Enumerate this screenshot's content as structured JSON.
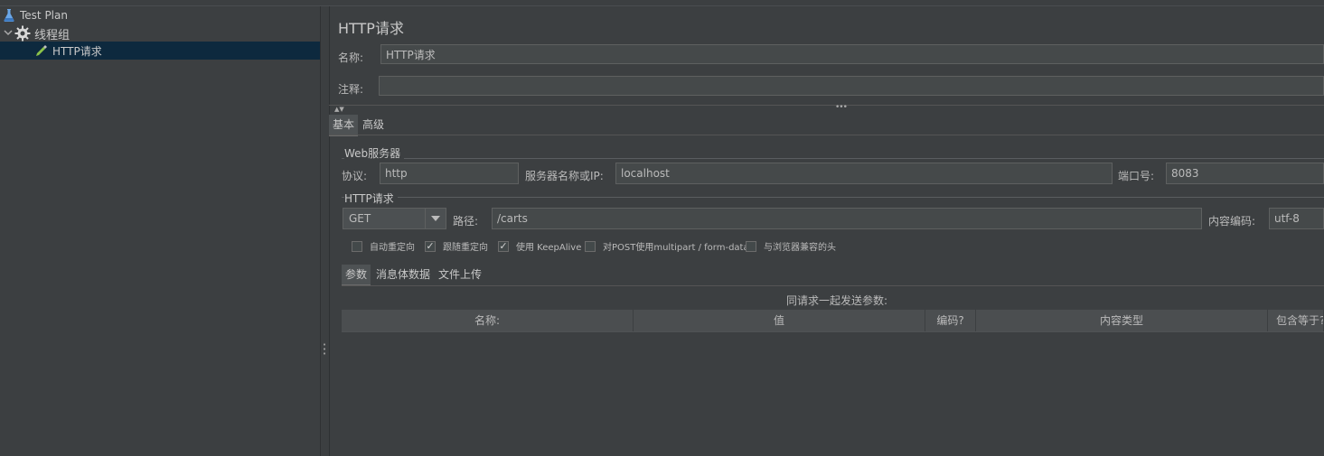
{
  "tree": {
    "items": [
      {
        "label": "Test Plan",
        "icon": "flask-icon"
      },
      {
        "label": "线程组",
        "icon": "gear-icon"
      },
      {
        "label": "HTTP请求",
        "icon": "pipette-icon"
      }
    ]
  },
  "panel": {
    "title": "HTTP请求",
    "name_label": "名称:",
    "name_value": "HTTP请求",
    "comment_label": "注释:",
    "comment_value": "",
    "tabs": [
      "基本",
      "高级"
    ],
    "web_server": {
      "title": "Web服务器",
      "protocol_label": "协议:",
      "protocol_value": "http",
      "server_label": "服务器名称或IP:",
      "server_value": "localhost",
      "port_label": "端口号:",
      "port_value": "8083"
    },
    "http_request": {
      "title": "HTTP请求",
      "method": "GET",
      "path_label": "路径:",
      "path_value": "/carts",
      "encoding_label": "内容编码:",
      "encoding_value": "utf-8"
    },
    "checkboxes": [
      {
        "label": "自动重定向",
        "checked": false
      },
      {
        "label": "跟随重定向",
        "checked": true
      },
      {
        "label": "使用 KeepAlive",
        "checked": true
      },
      {
        "label": "对POST使用multipart / form-data",
        "checked": false
      },
      {
        "label": "与浏览器兼容的头",
        "checked": false
      }
    ],
    "sub_tabs": [
      "参数",
      "消息体数据",
      "文件上传"
    ],
    "params_caption": "同请求一起发送参数:",
    "table_headers": [
      "名称:",
      "值",
      "编码?",
      "内容类型",
      "包含等于?"
    ]
  }
}
